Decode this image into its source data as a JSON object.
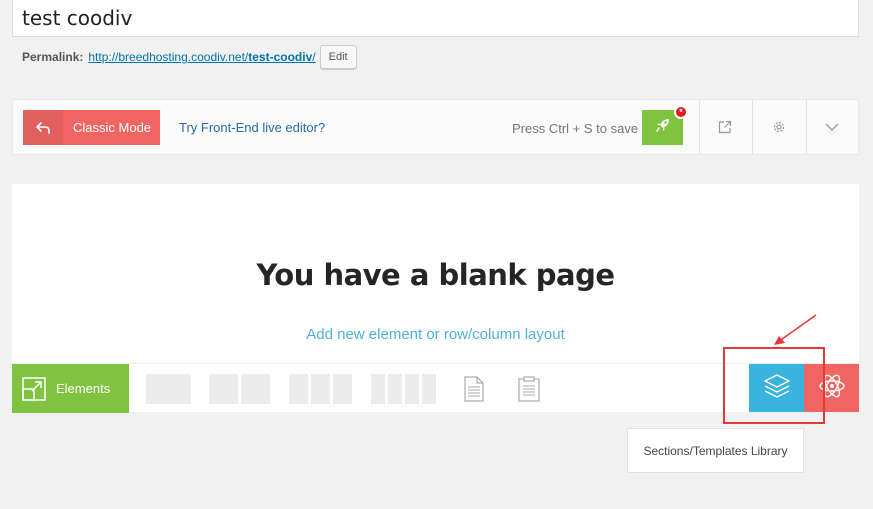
{
  "post": {
    "title": "test coodiv",
    "permalink_label": "Permalink:",
    "permalink_base": "http://breedhosting.coodiv.net/",
    "permalink_slug": "test-coodiv",
    "permalink_trail": "/",
    "edit_label": "Edit"
  },
  "toolbar": {
    "classic_mode_label": "Classic Mode",
    "frontend_link": "Try Front-End live editor?",
    "save_hint": "Press Ctrl + S to save",
    "badge": "*",
    "icons": [
      "undo-arrow-icon",
      "rocket-icon",
      "share-icon",
      "gear-icon",
      "chevron-down-icon"
    ]
  },
  "canvas": {
    "blank_title": "You have a blank page",
    "add_element_link": "Add new element or row/column layout"
  },
  "element_bar": {
    "elements_label": "Elements",
    "layouts": [
      "1-column",
      "2-columns",
      "3-columns",
      "4-columns"
    ],
    "icons": [
      "elements-icon",
      "document-icon",
      "clipboard-icon",
      "layers-icon",
      "atom-icon"
    ]
  },
  "tooltip": {
    "text": "Sections/Templates Library"
  },
  "colors": {
    "green": "#80c341",
    "red": "#f06562",
    "blue": "#38b4df",
    "link": "#0073aa",
    "annotation_red": "#e53935"
  }
}
